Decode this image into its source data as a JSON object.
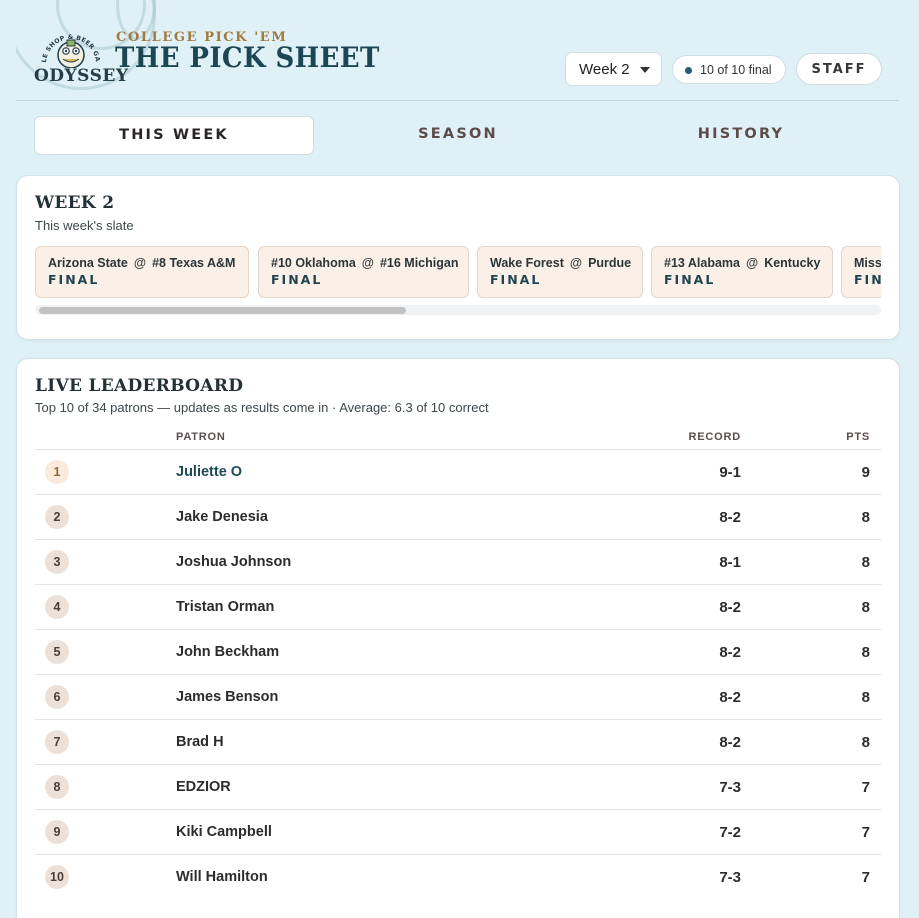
{
  "brand": {
    "kicker": "COLLEGE PICK 'EM",
    "title": "THE PICK SHEET",
    "logo_word": "ODYSSEY",
    "logo_seal": "BOTTLE SHOP & BEER GARDEN"
  },
  "header": {
    "week_select": "Week 2",
    "status": "10 of 10 final",
    "staff_button": "STAFF"
  },
  "tabs": [
    {
      "label": "THIS WEEK",
      "active": true
    },
    {
      "label": "SEASON",
      "active": false
    },
    {
      "label": "HISTORY",
      "active": false
    }
  ],
  "slate": {
    "title": "WEEK 2",
    "subtitle": "This week's slate",
    "games": [
      {
        "away": "Arizona State",
        "home": "#8 Texas A&M",
        "status": "FINAL"
      },
      {
        "away": "#10 Oklahoma",
        "home": "#16 Michigan",
        "status": "FINAL"
      },
      {
        "away": "Wake Forest",
        "home": "Purdue",
        "status": "FINAL"
      },
      {
        "away": "#13 Alabama",
        "home": "Kentucky",
        "status": "FINAL"
      },
      {
        "away": "Miss",
        "home": "",
        "status": "FIN"
      }
    ]
  },
  "leaderboard": {
    "title": "LIVE LEADERBOARD",
    "subtitle": "Top 10 of 34 patrons — updates as results come in · Average: 6.3 of 10 correct",
    "columns": {
      "patron": "PATRON",
      "record": "RECORD",
      "pts": "PTS"
    },
    "rows": [
      {
        "rank": "1",
        "name": "Juliette O",
        "record": "9-1",
        "pts": "9"
      },
      {
        "rank": "2",
        "name": "Jake Denesia",
        "record": "8-2",
        "pts": "8"
      },
      {
        "rank": "3",
        "name": "Joshua Johnson",
        "record": "8-1",
        "pts": "8"
      },
      {
        "rank": "4",
        "name": "Tristan Orman",
        "record": "8-2",
        "pts": "8"
      },
      {
        "rank": "5",
        "name": "John Beckham",
        "record": "8-2",
        "pts": "8"
      },
      {
        "rank": "6",
        "name": "James Benson",
        "record": "8-2",
        "pts": "8"
      },
      {
        "rank": "7",
        "name": "Brad H",
        "record": "8-2",
        "pts": "8"
      },
      {
        "rank": "8",
        "name": "EDZIOR",
        "record": "7-3",
        "pts": "7"
      },
      {
        "rank": "9",
        "name": "Kiki Campbell",
        "record": "7-2",
        "pts": "7"
      },
      {
        "rank": "10",
        "name": "Will Hamilton",
        "record": "7-3",
        "pts": "7"
      }
    ]
  },
  "colors": {
    "background": "#dff0f6",
    "brand_teal": "#1c4653",
    "accent_gold": "#a07a3c",
    "game_card": "#faf0e7"
  }
}
